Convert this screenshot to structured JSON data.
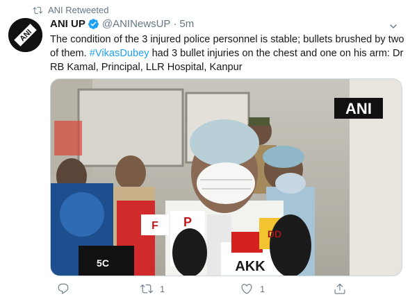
{
  "retweet": {
    "label": "ANI Retweeted",
    "icon": "retweet-icon"
  },
  "author": {
    "name": "ANI UP",
    "handle": "@ANINewsUP",
    "separator": "·",
    "time": "5m",
    "avatar_text": "ANI",
    "verified_icon": "verified-badge-icon"
  },
  "tweet": {
    "text_part1": "The condition of the 3 injured police personnel is stable; bullets brushed by two of them. ",
    "hashtag": "#VikasDubey",
    "text_part2": " had 3 bullet injuries on the chest and one on his arm: Dr RB Kamal, Principal, LLR Hospital, Kanpur"
  },
  "media": {
    "watermark": "ANI",
    "mic_labels": [
      "AKK",
      "DD",
      "P",
      "F",
      "5C"
    ]
  },
  "actions": {
    "reply_count": "",
    "retweet_count": "1",
    "like_count": "1"
  },
  "colors": {
    "link": "#1da1f2",
    "muted": "#657786",
    "text": "#14171a"
  }
}
